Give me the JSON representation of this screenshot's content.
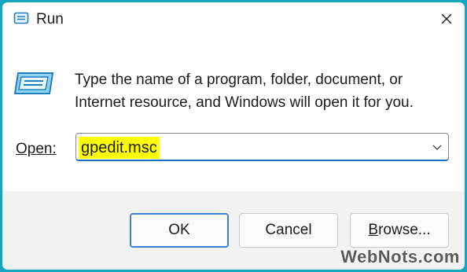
{
  "window": {
    "title": "Run",
    "close_symbol": "✕"
  },
  "dialog": {
    "description_line1": "Type the name of a program, folder, document, or",
    "description_line2": "Internet resource, and Windows will open it for you.",
    "open_label": "Open:",
    "open_value": "gpedit.msc"
  },
  "buttons": {
    "ok": "OK",
    "cancel": "Cancel",
    "browse_first": "B",
    "browse_rest": "rowse..."
  },
  "watermark": "WebNots.com",
  "icons": {
    "title_icon": "run-icon",
    "dialog_icon": "run-dialog-icon",
    "close": "close-icon",
    "dropdown": "chevron-down-icon"
  },
  "colors": {
    "accent_border": "#15a7be",
    "highlight": "#ffff00",
    "focus": "#1f6fbf"
  }
}
